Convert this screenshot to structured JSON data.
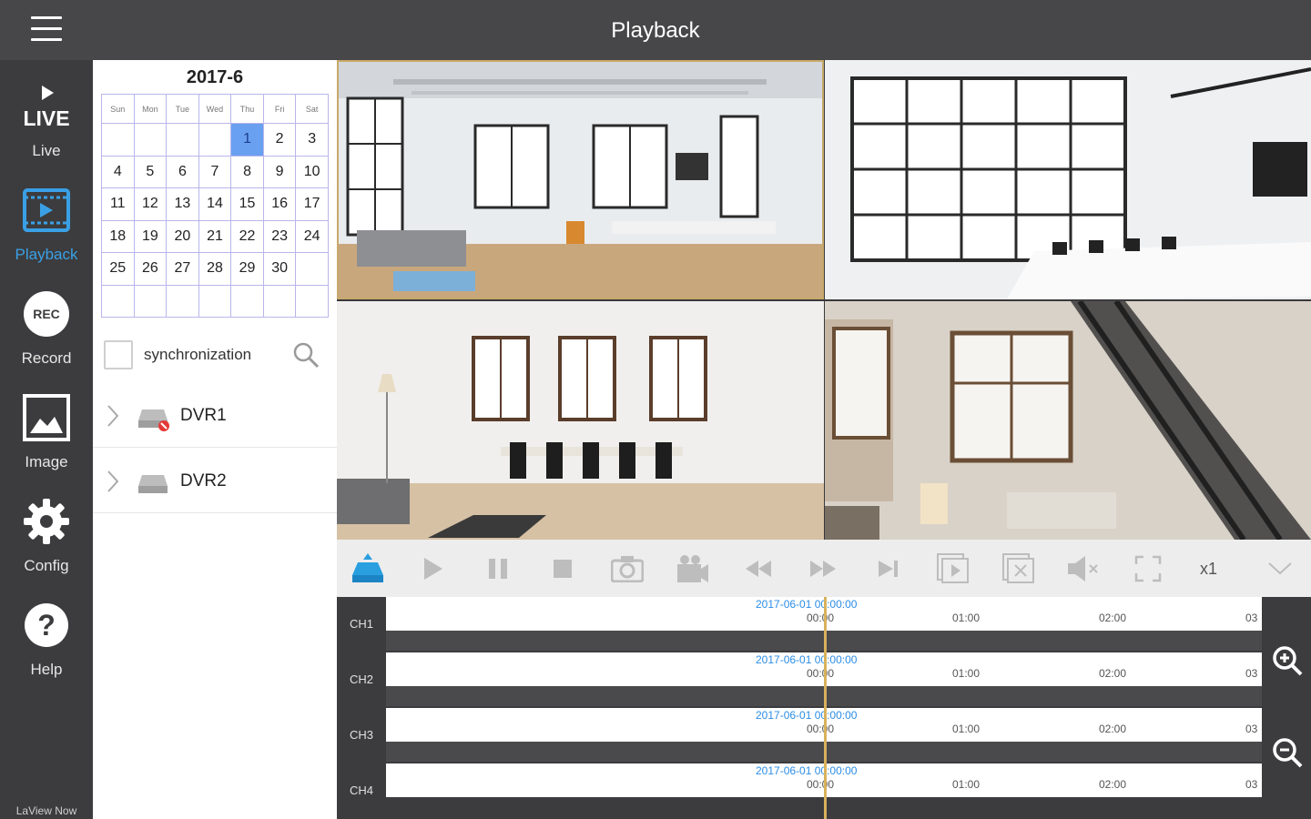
{
  "header": {
    "title": "Playback"
  },
  "nav": {
    "items": [
      {
        "label": "Live",
        "icon": "live-icon"
      },
      {
        "label": "Playback",
        "icon": "playback-icon"
      },
      {
        "label": "Record",
        "icon": "rec-icon",
        "badge": "REC"
      },
      {
        "label": "Image",
        "icon": "image-icon"
      },
      {
        "label": "Config",
        "icon": "gear-icon"
      },
      {
        "label": "Help",
        "icon": "help-icon"
      }
    ],
    "brand": "LaView Now",
    "live_icon_text": "LIVE",
    "accent": "#3aa0e6"
  },
  "calendar": {
    "title": "2017-6",
    "weekdays": [
      "Sun",
      "Mon",
      "Tue",
      "Wed",
      "Thu",
      "Fri",
      "Sat"
    ],
    "weeks": [
      [
        "",
        "",
        "",
        "",
        "1",
        "2",
        "3"
      ],
      [
        "4",
        "5",
        "6",
        "7",
        "8",
        "9",
        "10"
      ],
      [
        "11",
        "12",
        "13",
        "14",
        "15",
        "16",
        "17"
      ],
      [
        "18",
        "19",
        "20",
        "21",
        "22",
        "23",
        "24"
      ],
      [
        "25",
        "26",
        "27",
        "28",
        "29",
        "30",
        ""
      ],
      [
        "",
        "",
        "",
        "",
        "",
        "",
        ""
      ]
    ],
    "selected": "1",
    "selected_color": "#6aa0f0"
  },
  "sync": {
    "label": "synchronization",
    "checked": false
  },
  "devices": [
    {
      "name": "DVR1",
      "status": "error"
    },
    {
      "name": "DVR2",
      "status": "normal"
    }
  ],
  "toolbar": {
    "buttons": [
      "dvr-select-icon",
      "play-icon",
      "pause-icon",
      "stop-icon",
      "camera-icon",
      "video-record-icon",
      "rewind-icon",
      "fast-forward-icon",
      "next-frame-icon",
      "single-play-icon",
      "close-window-icon",
      "mute-icon",
      "fullscreen-icon"
    ],
    "speed": "x1",
    "more": "chevron-down-icon"
  },
  "timeline": {
    "channels": [
      {
        "label": "CH1",
        "timestamp": "2017-06-01 00:00:00"
      },
      {
        "label": "CH2",
        "timestamp": "2017-06-01 00:00:00"
      },
      {
        "label": "CH3",
        "timestamp": "2017-06-01 00:00:00"
      },
      {
        "label": "CH4",
        "timestamp": "2017-06-01 00:00:00"
      }
    ],
    "ticks": [
      "00:00",
      "01:00",
      "02:00",
      "03"
    ],
    "playhead_color": "#d8b25c"
  }
}
